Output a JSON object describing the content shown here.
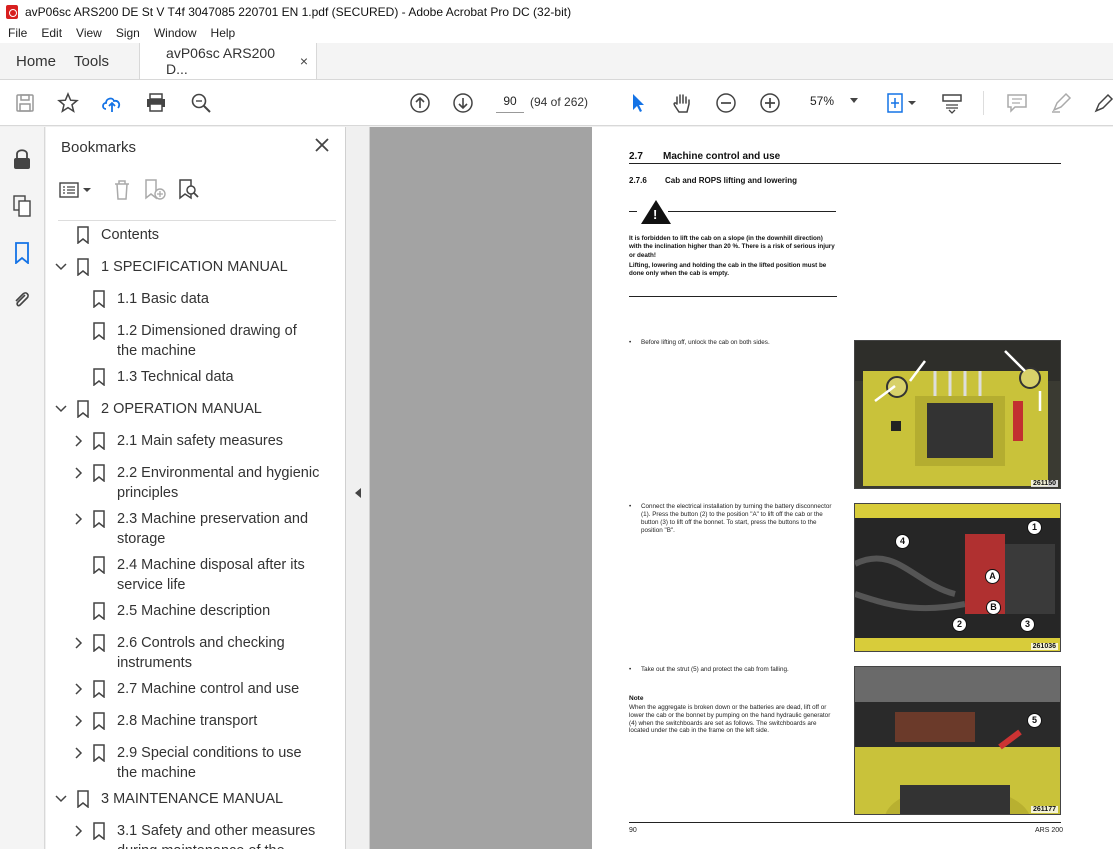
{
  "window": {
    "title": "avP06sc ARS200 DE St V T4f 3047085 220701 EN 1.pdf (SECURED) - Adobe Acrobat Pro DC (32-bit)"
  },
  "menu": [
    "File",
    "Edit",
    "View",
    "Sign",
    "Window",
    "Help"
  ],
  "tabs": {
    "home": "Home",
    "tools": "Tools",
    "document": "avP06sc ARS200 D...",
    "close": "×"
  },
  "toolbar": {
    "page_number": "90",
    "page_count": "(94 of 262)",
    "zoom": "57%"
  },
  "bookmarks": {
    "title": "Bookmarks",
    "items": [
      {
        "label": "Contents"
      },
      {
        "label": "1 SPECIFICATION MANUAL"
      },
      {
        "label": "1.1 Basic data"
      },
      {
        "label": "1.2 Dimensioned drawing of",
        "label2": "the machine"
      },
      {
        "label": "1.3 Technical data"
      },
      {
        "label": "2 OPERATION MANUAL"
      },
      {
        "label": "2.1 Main safety measures"
      },
      {
        "label": "2.2 Environmental and hygienic",
        "label2": "principles"
      },
      {
        "label": "2.3 Machine preservation and",
        "label2": "storage"
      },
      {
        "label": "2.4 Machine disposal after its",
        "label2": "service life"
      },
      {
        "label": "2.5 Machine description"
      },
      {
        "label": "2.6 Controls and checking",
        "label2": "instruments"
      },
      {
        "label": "2.7 Machine control and use"
      },
      {
        "label": "2.8 Machine transport"
      },
      {
        "label": "2.9 Special conditions to use",
        "label2": "the machine"
      },
      {
        "label": "3 MAINTENANCE MANUAL"
      },
      {
        "label": "3.1 Safety and other measures",
        "label2": "during maintenance of the"
      }
    ]
  },
  "page": {
    "section_num": "2.7",
    "section_title": "Machine control and use",
    "subsection_num": "2.7.6",
    "subsection_title": "Cab and ROPS lifting and lowering",
    "warning_1": "It is forbidden to lift the cab on a slope (in the downhill direction) with the inclination higher than 20 %. There is a risk of serious injury or death!",
    "warning_2": "Lifting, lowering and holding the cab in the lifted position must be done only when the cab is empty.",
    "bullet_1": "Before lifting off, unlock the cab on both sides.",
    "bullet_2": "Connect the electrical installation by turning the battery disconnector (1). Press the button (2) to the position \"A\" to lift off the cab or the button (3) to lift off the bonnet. To start, press the buttons to the position \"B\".",
    "bullet_3": "Take out the strut (5) and protect the cab from falling.",
    "note_heading": "Note",
    "note_text": "When the aggregate is broken down or the batteries are dead, lift off or lower the cab or the bonnet by pumping on the hand hydraulic generator (4) when the switchboards are set as follows. The switchboards are located under the cab in the frame on the left side.",
    "photo_codes": [
      "261150",
      "261036",
      "261177"
    ],
    "callouts": [
      "1",
      "A",
      "4",
      "B",
      "2",
      "3",
      "5"
    ],
    "footer_left": "90",
    "footer_right": "ARS 200"
  }
}
